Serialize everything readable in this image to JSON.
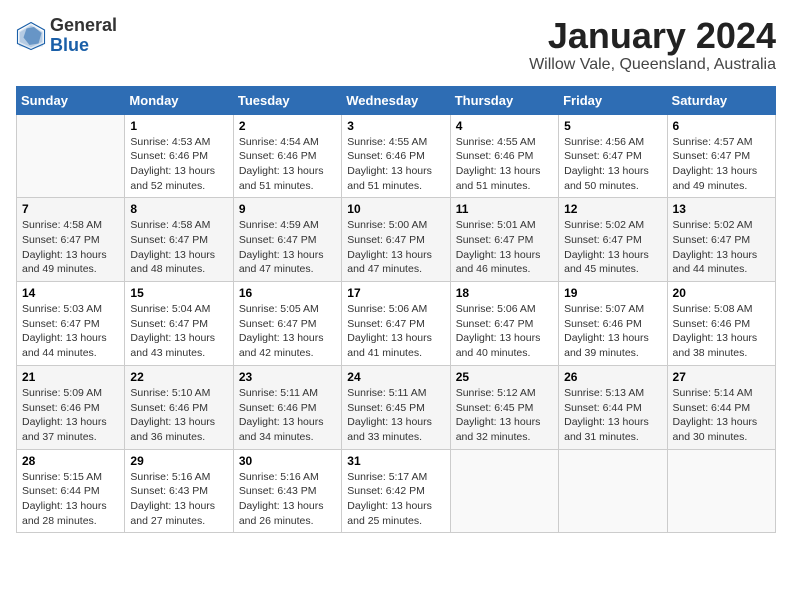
{
  "logo": {
    "general": "General",
    "blue": "Blue"
  },
  "header": {
    "title": "January 2024",
    "subtitle": "Willow Vale, Queensland, Australia"
  },
  "calendar": {
    "days_of_week": [
      "Sunday",
      "Monday",
      "Tuesday",
      "Wednesday",
      "Thursday",
      "Friday",
      "Saturday"
    ],
    "weeks": [
      [
        {
          "num": "",
          "info": ""
        },
        {
          "num": "1",
          "info": "Sunrise: 4:53 AM\nSunset: 6:46 PM\nDaylight: 13 hours\nand 52 minutes."
        },
        {
          "num": "2",
          "info": "Sunrise: 4:54 AM\nSunset: 6:46 PM\nDaylight: 13 hours\nand 51 minutes."
        },
        {
          "num": "3",
          "info": "Sunrise: 4:55 AM\nSunset: 6:46 PM\nDaylight: 13 hours\nand 51 minutes."
        },
        {
          "num": "4",
          "info": "Sunrise: 4:55 AM\nSunset: 6:46 PM\nDaylight: 13 hours\nand 51 minutes."
        },
        {
          "num": "5",
          "info": "Sunrise: 4:56 AM\nSunset: 6:47 PM\nDaylight: 13 hours\nand 50 minutes."
        },
        {
          "num": "6",
          "info": "Sunrise: 4:57 AM\nSunset: 6:47 PM\nDaylight: 13 hours\nand 49 minutes."
        }
      ],
      [
        {
          "num": "7",
          "info": "Sunrise: 4:58 AM\nSunset: 6:47 PM\nDaylight: 13 hours\nand 49 minutes."
        },
        {
          "num": "8",
          "info": "Sunrise: 4:58 AM\nSunset: 6:47 PM\nDaylight: 13 hours\nand 48 minutes."
        },
        {
          "num": "9",
          "info": "Sunrise: 4:59 AM\nSunset: 6:47 PM\nDaylight: 13 hours\nand 47 minutes."
        },
        {
          "num": "10",
          "info": "Sunrise: 5:00 AM\nSunset: 6:47 PM\nDaylight: 13 hours\nand 47 minutes."
        },
        {
          "num": "11",
          "info": "Sunrise: 5:01 AM\nSunset: 6:47 PM\nDaylight: 13 hours\nand 46 minutes."
        },
        {
          "num": "12",
          "info": "Sunrise: 5:02 AM\nSunset: 6:47 PM\nDaylight: 13 hours\nand 45 minutes."
        },
        {
          "num": "13",
          "info": "Sunrise: 5:02 AM\nSunset: 6:47 PM\nDaylight: 13 hours\nand 44 minutes."
        }
      ],
      [
        {
          "num": "14",
          "info": "Sunrise: 5:03 AM\nSunset: 6:47 PM\nDaylight: 13 hours\nand 44 minutes."
        },
        {
          "num": "15",
          "info": "Sunrise: 5:04 AM\nSunset: 6:47 PM\nDaylight: 13 hours\nand 43 minutes."
        },
        {
          "num": "16",
          "info": "Sunrise: 5:05 AM\nSunset: 6:47 PM\nDaylight: 13 hours\nand 42 minutes."
        },
        {
          "num": "17",
          "info": "Sunrise: 5:06 AM\nSunset: 6:47 PM\nDaylight: 13 hours\nand 41 minutes."
        },
        {
          "num": "18",
          "info": "Sunrise: 5:06 AM\nSunset: 6:47 PM\nDaylight: 13 hours\nand 40 minutes."
        },
        {
          "num": "19",
          "info": "Sunrise: 5:07 AM\nSunset: 6:46 PM\nDaylight: 13 hours\nand 39 minutes."
        },
        {
          "num": "20",
          "info": "Sunrise: 5:08 AM\nSunset: 6:46 PM\nDaylight: 13 hours\nand 38 minutes."
        }
      ],
      [
        {
          "num": "21",
          "info": "Sunrise: 5:09 AM\nSunset: 6:46 PM\nDaylight: 13 hours\nand 37 minutes."
        },
        {
          "num": "22",
          "info": "Sunrise: 5:10 AM\nSunset: 6:46 PM\nDaylight: 13 hours\nand 36 minutes."
        },
        {
          "num": "23",
          "info": "Sunrise: 5:11 AM\nSunset: 6:46 PM\nDaylight: 13 hours\nand 34 minutes."
        },
        {
          "num": "24",
          "info": "Sunrise: 5:11 AM\nSunset: 6:45 PM\nDaylight: 13 hours\nand 33 minutes."
        },
        {
          "num": "25",
          "info": "Sunrise: 5:12 AM\nSunset: 6:45 PM\nDaylight: 13 hours\nand 32 minutes."
        },
        {
          "num": "26",
          "info": "Sunrise: 5:13 AM\nSunset: 6:44 PM\nDaylight: 13 hours\nand 31 minutes."
        },
        {
          "num": "27",
          "info": "Sunrise: 5:14 AM\nSunset: 6:44 PM\nDaylight: 13 hours\nand 30 minutes."
        }
      ],
      [
        {
          "num": "28",
          "info": "Sunrise: 5:15 AM\nSunset: 6:44 PM\nDaylight: 13 hours\nand 28 minutes."
        },
        {
          "num": "29",
          "info": "Sunrise: 5:16 AM\nSunset: 6:43 PM\nDaylight: 13 hours\nand 27 minutes."
        },
        {
          "num": "30",
          "info": "Sunrise: 5:16 AM\nSunset: 6:43 PM\nDaylight: 13 hours\nand 26 minutes."
        },
        {
          "num": "31",
          "info": "Sunrise: 5:17 AM\nSunset: 6:42 PM\nDaylight: 13 hours\nand 25 minutes."
        },
        {
          "num": "",
          "info": ""
        },
        {
          "num": "",
          "info": ""
        },
        {
          "num": "",
          "info": ""
        }
      ]
    ]
  }
}
